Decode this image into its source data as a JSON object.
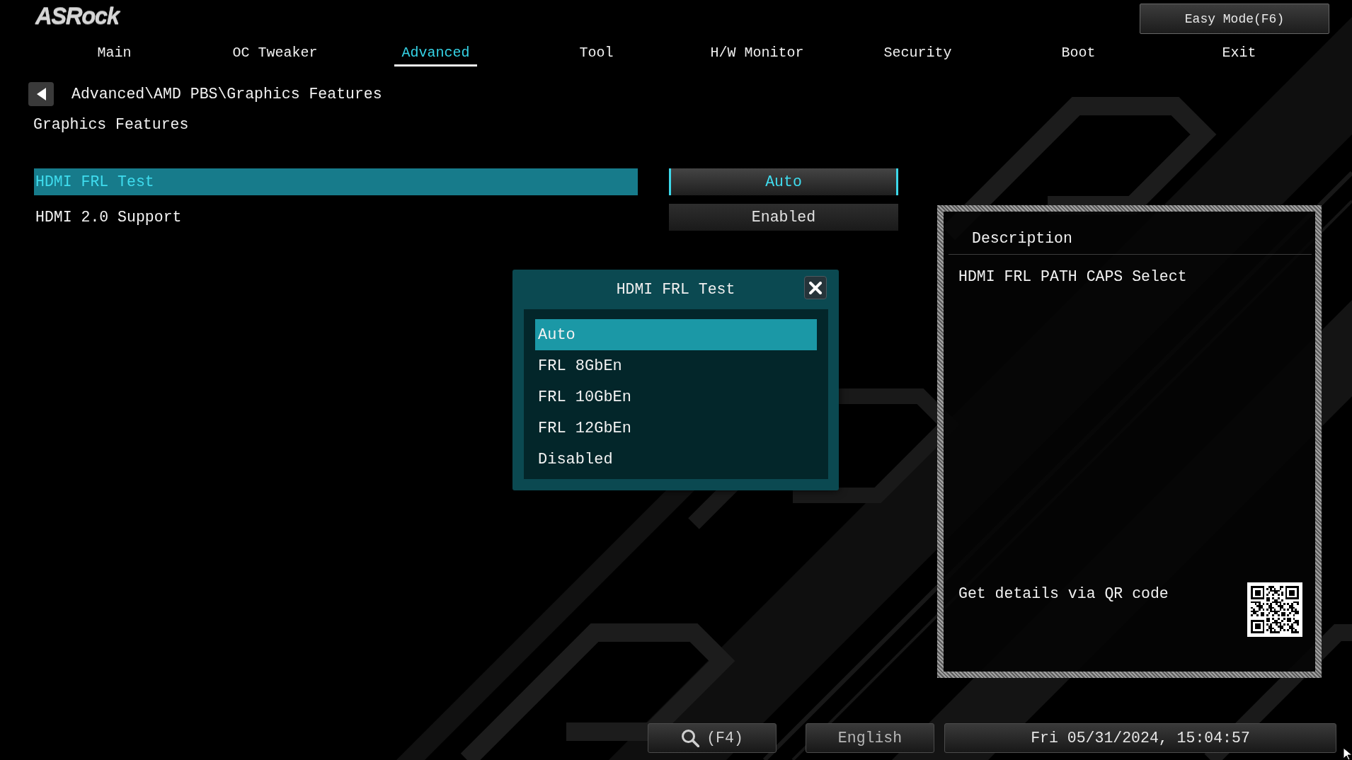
{
  "header": {
    "logo": "ASRock",
    "easy_mode": "Easy Mode(F6)"
  },
  "tabs": [
    {
      "label": "Main",
      "selected": false
    },
    {
      "label": "OC Tweaker",
      "selected": false
    },
    {
      "label": "Advanced",
      "selected": true
    },
    {
      "label": "Tool",
      "selected": false
    },
    {
      "label": "H/W Monitor",
      "selected": false
    },
    {
      "label": "Security",
      "selected": false
    },
    {
      "label": "Boot",
      "selected": false
    },
    {
      "label": "Exit",
      "selected": false
    }
  ],
  "breadcrumb": {
    "path": "Advanced\\AMD PBS\\Graphics Features"
  },
  "section_title": "Graphics Features",
  "settings": [
    {
      "label": "HDMI FRL Test",
      "value": "Auto",
      "selected": true
    },
    {
      "label": "HDMI 2.0 Support",
      "value": "Enabled",
      "selected": false
    }
  ],
  "popup": {
    "title": "HDMI FRL Test",
    "options": [
      {
        "label": "Auto",
        "selected": true
      },
      {
        "label": "FRL 8GbEn",
        "selected": false
      },
      {
        "label": "FRL 10GbEn",
        "selected": false
      },
      {
        "label": "FRL 12GbEn",
        "selected": false
      },
      {
        "label": "Disabled",
        "selected": false
      }
    ]
  },
  "description": {
    "title": "Description",
    "text": "HDMI FRL PATH CAPS Select",
    "qr_caption": "Get details via QR code"
  },
  "status_bar": {
    "search_shortcut": "(F4)",
    "language": "English",
    "datetime": "Fri 05/31/2024, 15:04:57"
  }
}
